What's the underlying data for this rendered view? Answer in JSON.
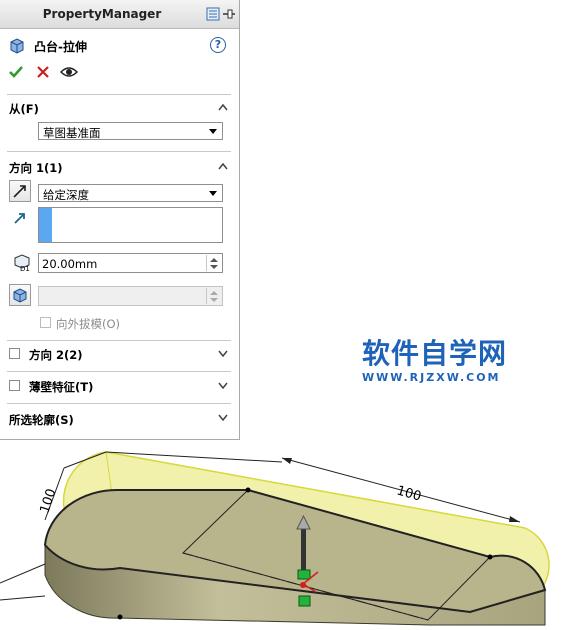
{
  "panel": {
    "title": "PropertyManager",
    "feature_name": "凸台-拉伸",
    "help_glyph": "?"
  },
  "sections": {
    "from": {
      "label": "从(F)",
      "value": "草图基准面"
    },
    "direction1": {
      "label": "方向 1(1)",
      "end_condition": "给定深度",
      "depth": "20.00mm",
      "draft_outward_label": "向外拔模(O)"
    },
    "direction2": {
      "label": "方向 2(2)"
    },
    "thin_feature": {
      "label": "薄壁特征(T)"
    },
    "selected_contours": {
      "label": "所选轮廓(S)"
    }
  },
  "viewport": {
    "dim_width": "100",
    "dim_length": "100"
  },
  "watermark": {
    "main": "软件自学网",
    "sub": "WWW.RJZXW.COM"
  },
  "colors": {
    "accent": "#1e63b8",
    "ok": "#2e9a2e",
    "cancel": "#cc2020",
    "preview_yellow": "#ecec9c",
    "solid": "#b9b48a"
  }
}
